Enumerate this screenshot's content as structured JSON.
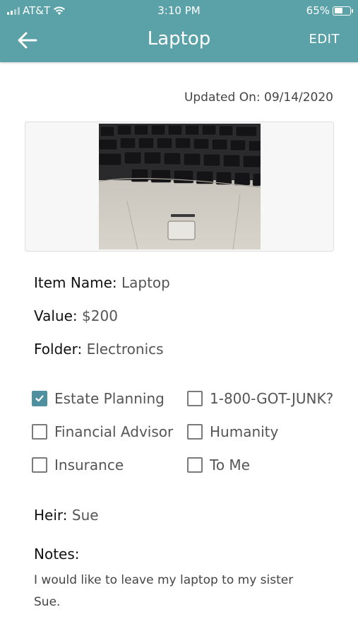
{
  "status": {
    "carrier": "AT&T",
    "time": "3:10 PM",
    "battery": "65%",
    "battery_level": 0.65
  },
  "header": {
    "title": "Laptop",
    "edit_label": "EDIT"
  },
  "updated": {
    "label": "Updated On:",
    "date": "09/14/2020"
  },
  "photo": {
    "description": "keyboard-and-touchpad-photo"
  },
  "fields": {
    "item_name": {
      "label": "Item Name:",
      "value": "Laptop"
    },
    "value": {
      "label": "Value:",
      "value": "$200"
    },
    "folder": {
      "label": "Folder:",
      "value": "Electronics"
    }
  },
  "options": [
    {
      "label": "Estate Planning",
      "checked": true
    },
    {
      "label": "1-800-GOT-JUNK?",
      "checked": false
    },
    {
      "label": "Financial Advisor",
      "checked": false
    },
    {
      "label": "Humanity",
      "checked": false
    },
    {
      "label": "Insurance",
      "checked": false
    },
    {
      "label": "To Me",
      "checked": false
    }
  ],
  "heir": {
    "label": "Heir:",
    "value": "Sue"
  },
  "notes": {
    "label": "Notes:",
    "text": "I would like to leave my laptop to my sister Sue."
  },
  "colors": {
    "header": "#5aa1a8",
    "accent": "#4e8fa0"
  }
}
